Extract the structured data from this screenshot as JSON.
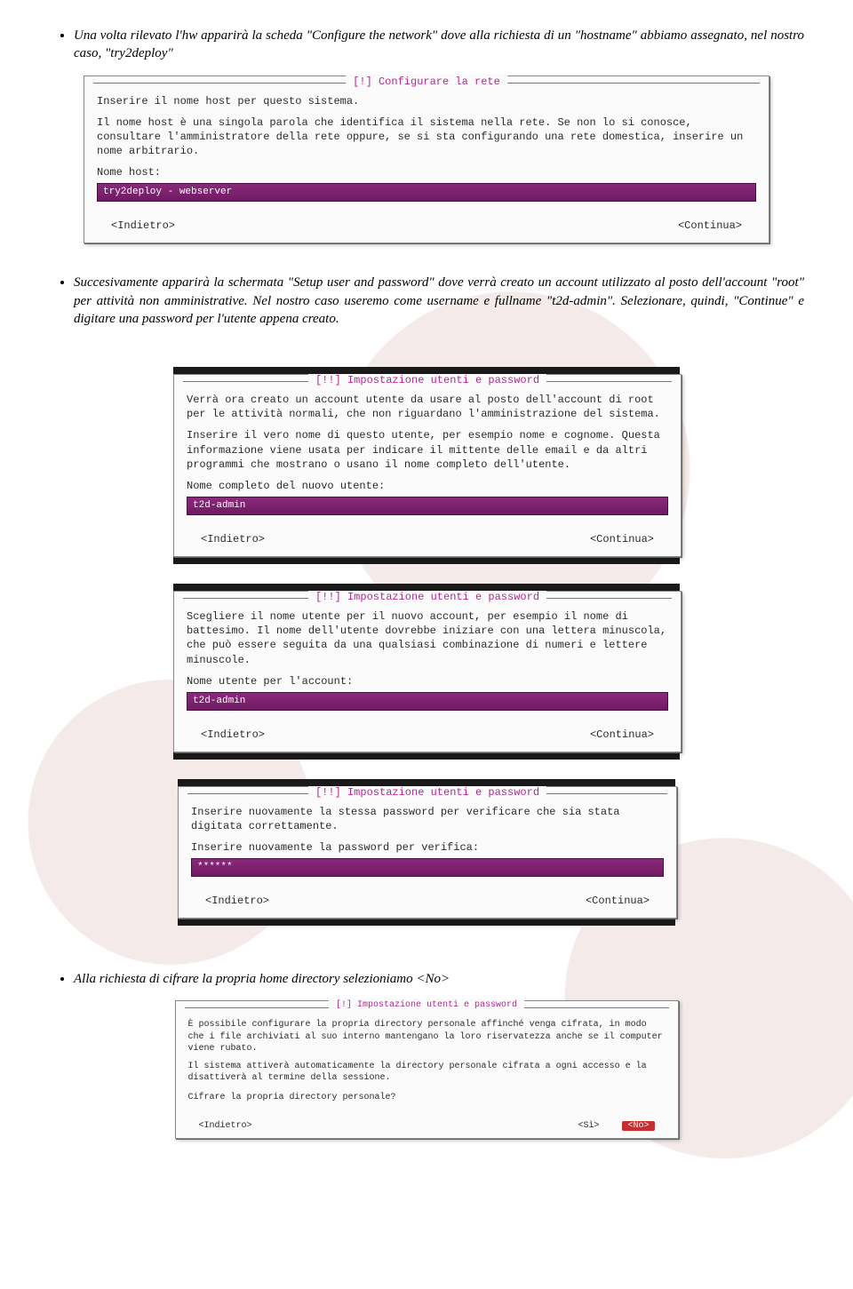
{
  "text": {
    "p1": "Una volta rilevato l'hw apparirà la scheda \"Configure the network\" dove alla richiesta di un \"hostname\" abbiamo assegnato, nel nostro caso, \"try2deploy\"",
    "p2": "Succesivamente apparirà la schermata \"Setup user and password\" dove verrà creato un account utilizzato al posto dell'account \"root\" per attività non amministrative. Nel nostro caso useremo come username e fullname \"t2d-admin\". Selezionare, quindi, \"Continue\" e digitare una password per l'utente appena creato.",
    "p3": "Alla richiesta di cifrare la propria home directory selezioniamo <No>"
  },
  "network": {
    "title": "[!] Configurare la rete",
    "line1": "Inserire il nome host per questo sistema.",
    "line2": "Il nome host è una singola parola che identifica il sistema nella rete. Se non lo si conosce, consultare l'amministratore della rete oppure, se si sta configurando una rete domestica, inserire un nome arbitrario.",
    "prompt": "Nome host:",
    "input": "try2deploy - webserver",
    "back": "<Indietro>",
    "cont": "<Continua>"
  },
  "user1": {
    "title": "[!!] Impostazione utenti e password",
    "line1": "Verrà ora creato un account utente da usare al posto dell'account di root per le attività normali, che non riguardano l'amministrazione del sistema.",
    "line2": "Inserire il vero nome di questo utente, per esempio nome e cognome. Questa informazione viene usata per indicare il mittente delle email e da altri programmi che mostrano o usano il nome completo dell'utente.",
    "prompt": "Nome completo del nuovo utente:",
    "input": "t2d-admin",
    "back": "<Indietro>",
    "cont": "<Continua>"
  },
  "user2": {
    "title": "[!!] Impostazione utenti e password",
    "line1": "Scegliere il nome utente per il nuovo account, per esempio il nome di battesimo. Il nome dell'utente dovrebbe iniziare con una lettera minuscola, che può essere seguita da una qualsiasi combinazione di numeri e lettere minuscole.",
    "prompt": "Nome utente per l'account:",
    "input": "t2d-admin",
    "back": "<Indietro>",
    "cont": "<Continua>"
  },
  "user3": {
    "title": "[!!] Impostazione utenti e password",
    "line1": "Inserire nuovamente la stessa password per verificare che sia stata digitata correttamente.",
    "prompt": "Inserire nuovamente la password per verifica:",
    "input": "******",
    "back": "<Indietro>",
    "cont": "<Continua>"
  },
  "encrypt": {
    "title": "[!] Impostazione utenti e password",
    "line1": "È possibile configurare la propria directory personale affinché venga cifrata, in modo che i file archiviati al suo interno mantengano la loro riservatezza anche se il computer viene rubato.",
    "line2": "Il sistema attiverà automaticamente la directory personale cifrata a ogni accesso e la disattiverà al termine della sessione.",
    "prompt": "Cifrare la propria directory personale?",
    "back": "<Indietro>",
    "yes": "<Sì>",
    "no": "<No>"
  }
}
